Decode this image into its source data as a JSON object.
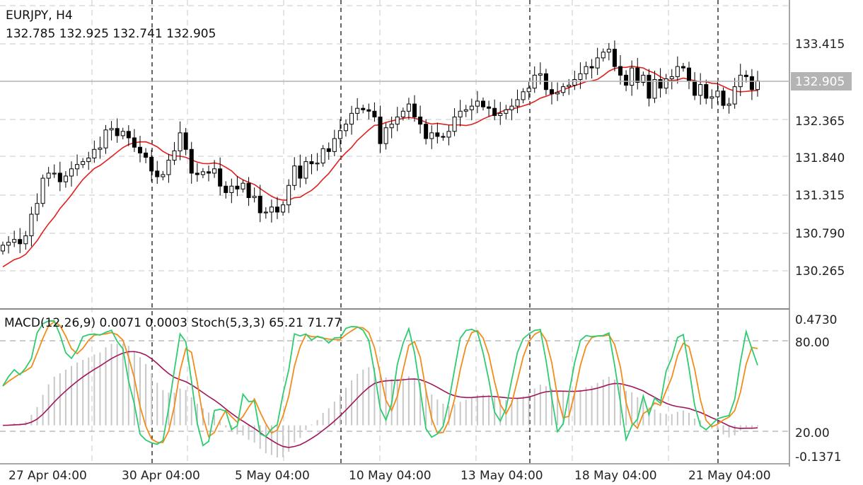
{
  "header": {
    "symbol_timeframe": "EURJPY, H4",
    "ohlc": "132.785 132.925 132.741 132.905"
  },
  "indicator_header": "MACD(12,26,9) 0.0071 0.0003 Stoch(5,3,3) 65.21 71.77",
  "colors": {
    "bull": "#ffffff",
    "bear": "#000000",
    "ma": "#e02020",
    "macd_hist": "#c8c8c8",
    "macd_signal": "#a0145a",
    "stoch_main": "#2ecc71",
    "stoch_signal": "#f28c1a",
    "grid": "#c8c8c8",
    "current_price_bg": "#b4b4b4"
  },
  "chart_data": [
    {
      "type": "candlestick",
      "title": "EURJPY, H4",
      "x_tick_labels": [
        "27 Apr 04:00",
        "30 Apr 04:00",
        "5 May 04:00",
        "10 May 04:00",
        "13 May 04:00",
        "18 May 04:00",
        "21 May 04:00"
      ],
      "y_tick_labels": [
        "133.415",
        "132.365",
        "131.840",
        "131.315",
        "130.790",
        "130.265"
      ],
      "ylim": [
        129.88,
        133.55
      ],
      "current_price": "132.905",
      "close_series": [
        130.62,
        130.66,
        130.7,
        130.64,
        130.75,
        131.05,
        131.2,
        131.55,
        131.62,
        131.62,
        131.5,
        131.58,
        131.68,
        131.74,
        131.78,
        131.83,
        131.95,
        131.97,
        132.22,
        132.24,
        132.14,
        132.2,
        132.11,
        131.98,
        131.9,
        131.84,
        131.65,
        131.57,
        131.6,
        131.8,
        131.93,
        132.18,
        131.95,
        131.62,
        131.6,
        131.64,
        131.62,
        131.68,
        131.44,
        131.35,
        131.44,
        131.4,
        131.48,
        131.28,
        131.3,
        131.07,
        131.08,
        131.15,
        131.08,
        131.18,
        131.45,
        131.72,
        131.55,
        131.78,
        131.75,
        131.76,
        131.96,
        131.92,
        132.1,
        132.21,
        132.3,
        132.45,
        132.52,
        132.5,
        132.48,
        132.4,
        132.03,
        132.25,
        132.3,
        132.4,
        132.48,
        132.58,
        132.4,
        132.3,
        132.1,
        132.18,
        132.13,
        132.12,
        132.2,
        132.4,
        132.48,
        132.5,
        132.55,
        132.62,
        132.54,
        132.52,
        132.42,
        132.45,
        132.5,
        132.55,
        132.64,
        132.75,
        132.8,
        132.98,
        133.0,
        132.78,
        132.72,
        132.74,
        132.82,
        132.84,
        132.92,
        133.0,
        133.1,
        133.08,
        133.22,
        133.3,
        133.34,
        133.1,
        132.98,
        132.84,
        133.08,
        132.88,
        132.98,
        132.66,
        132.92,
        132.8,
        132.93,
        132.96,
        133.1,
        133.08,
        132.9,
        132.7,
        132.85,
        132.66,
        132.68,
        132.76,
        132.56,
        132.58,
        132.82,
        132.98,
        132.96,
        132.78,
        132.9
      ]
    },
    {
      "type": "indicators",
      "title": "MACD(12,26,9) 0.0071 0.0003 Stoch(5,3,3) 65.21 71.77",
      "y_tick_labels": [
        "0.4730",
        "80.00",
        "20.00",
        "-0.1371"
      ],
      "stoch_levels": [
        80,
        20
      ]
    }
  ]
}
